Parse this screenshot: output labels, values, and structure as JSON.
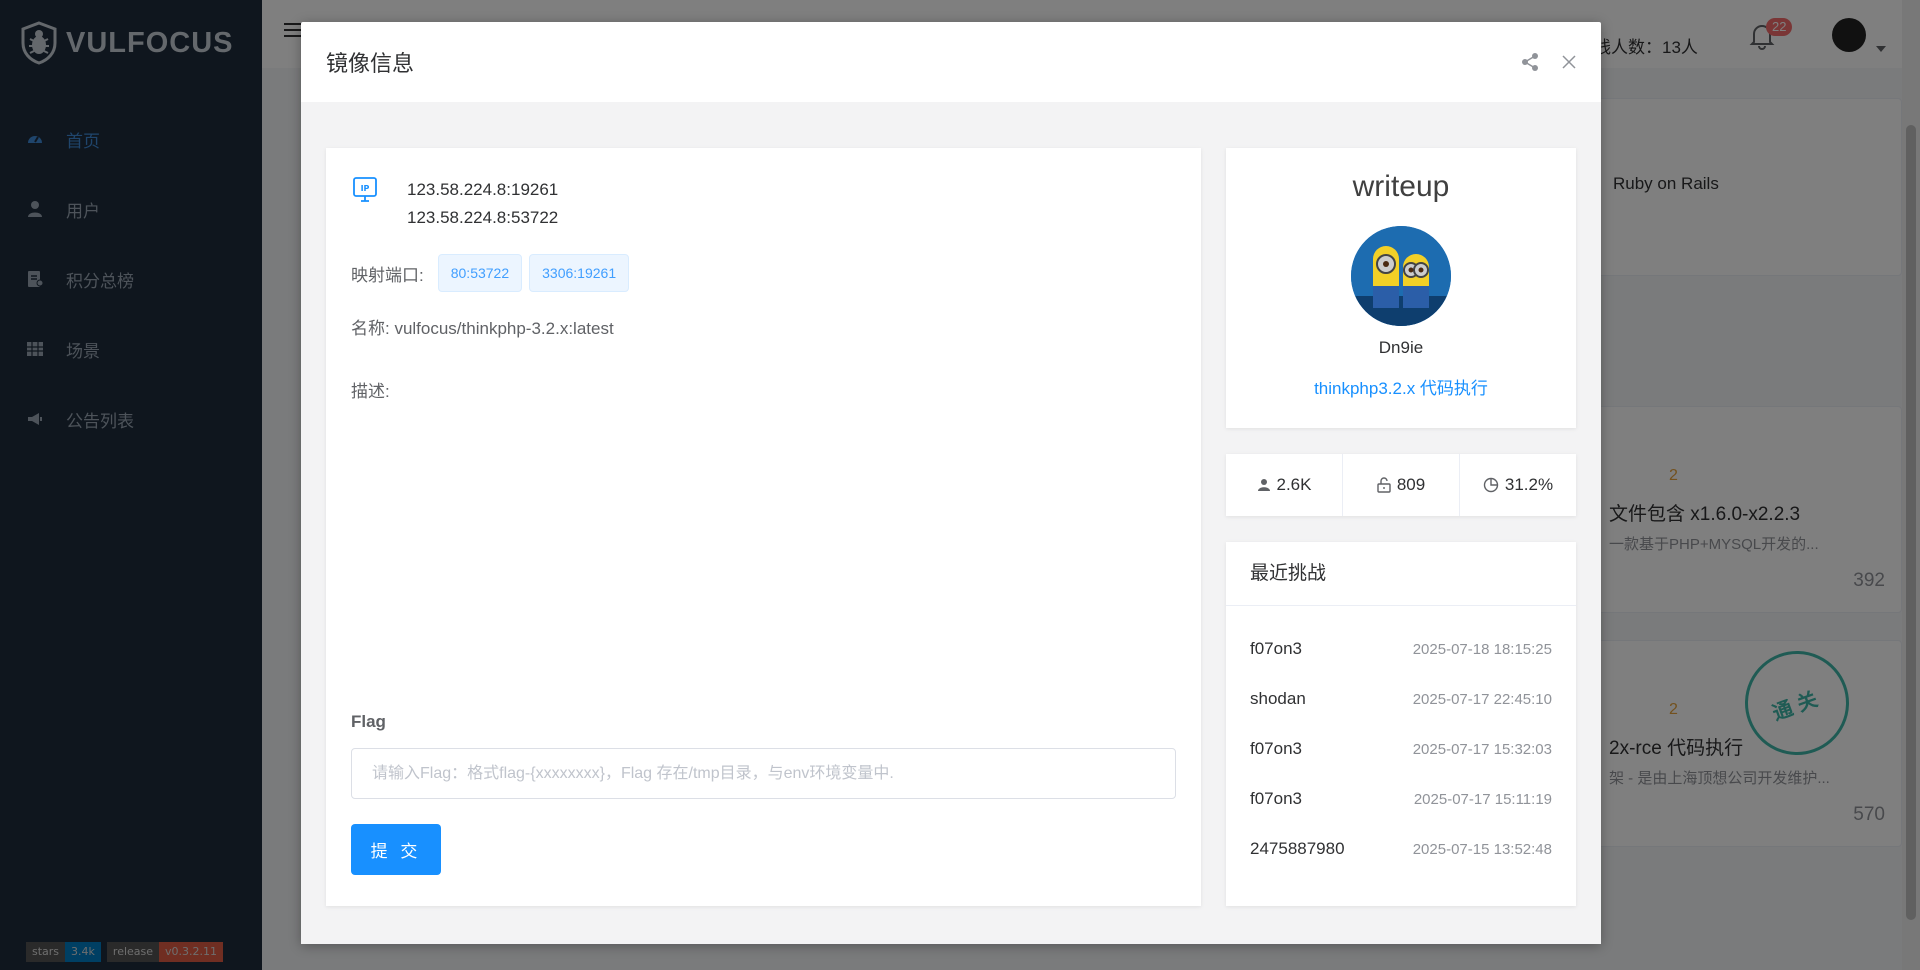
{
  "sidebar": {
    "logo_text": "VULFOCUS",
    "items": [
      {
        "label": "首页",
        "icon": "dashboard-icon",
        "active": true
      },
      {
        "label": "用户",
        "icon": "user-icon"
      },
      {
        "label": "积分总榜",
        "icon": "leaderboard-icon"
      },
      {
        "label": "场景",
        "icon": "grid-icon"
      },
      {
        "label": "公告列表",
        "icon": "megaphone-icon"
      }
    ],
    "badges": {
      "stars_label": "stars",
      "stars_value": "3.4k",
      "release_label": "release",
      "release_value": "v0.3.2.11"
    }
  },
  "topbar": {
    "online_text": "线人数：13人",
    "notification_count": "22"
  },
  "background": {
    "card1_label": "Ruby on Rails",
    "card2_rating": "2",
    "card2_title": "文件包含 x1.6.0-x2.2.3",
    "card2_desc": "一款基于PHP+MYSQL开发的...",
    "card2_count": "392",
    "card3_rating": "2",
    "card3_title": "2x-rce 代码执行",
    "card3_desc": "架 - 是由上海顶想公司开发维护...",
    "card3_count": "570",
    "card3_stamp": "通关"
  },
  "modal": {
    "title": "镜像信息",
    "ip_lines": [
      "123.58.224.8:19261",
      "123.58.224.8:53722"
    ],
    "port_label": "映射端口:",
    "ports": [
      "80:53722",
      "3306:19261"
    ],
    "name_text": "名称: vulfocus/thinkphp-3.2.x:latest",
    "desc_label": "描述:",
    "flag_label": "Flag",
    "flag_placeholder": "请输入Flag：格式flag-{xxxxxxxx}，Flag 存在/tmp目录，与env环境变量中.",
    "submit_label": "提 交",
    "writeup": {
      "title": "writeup",
      "author": "Dn9ie",
      "link": "thinkphp3.2.x 代码执行"
    },
    "stats": {
      "users": "2.6K",
      "solved": "809",
      "rate": "31.2%"
    },
    "recent": {
      "title": "最近挑战",
      "rows": [
        {
          "user": "f07on3",
          "time": "2025-07-18 18:15:25"
        },
        {
          "user": "shodan",
          "time": "2025-07-17 22:45:10"
        },
        {
          "user": "f07on3",
          "time": "2025-07-17 15:32:03"
        },
        {
          "user": "f07on3",
          "time": "2025-07-17 15:11:19"
        },
        {
          "user": "2475887980",
          "time": "2025-07-15 13:52:48"
        }
      ]
    }
  },
  "colors": {
    "sidebar_bg": "#1f2d3d",
    "primary": "#1890ff",
    "stars_badge": "#007ec6",
    "release_badge": "#e05d44"
  }
}
